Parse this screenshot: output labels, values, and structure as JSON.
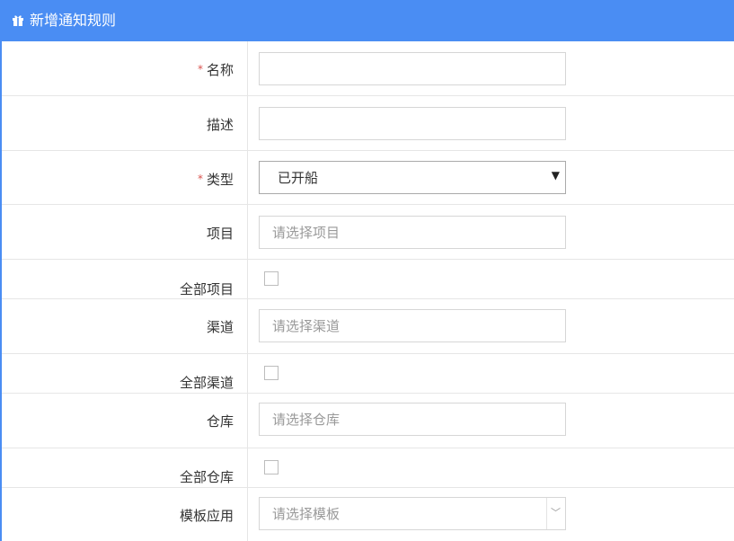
{
  "header": {
    "title": "新增通知规则",
    "icon": "gift-icon"
  },
  "form": {
    "name": {
      "label": "名称",
      "required_mark": "*",
      "value": ""
    },
    "description": {
      "label": "描述",
      "value": ""
    },
    "type": {
      "label": "类型",
      "required_mark": "*",
      "selected": "已开船"
    },
    "project": {
      "label": "项目",
      "placeholder": "请选择项目"
    },
    "all_projects": {
      "label": "全部项目",
      "checked": false
    },
    "channel": {
      "label": "渠道",
      "placeholder": "请选择渠道"
    },
    "all_channels": {
      "label": "全部渠道",
      "checked": false
    },
    "warehouse": {
      "label": "仓库",
      "placeholder": "请选择仓库"
    },
    "all_warehouses": {
      "label": "全部仓库",
      "checked": false
    },
    "template": {
      "label": "模板应用",
      "placeholder": "请选择模板"
    }
  },
  "colors": {
    "accent": "#4a8df3",
    "required": "#d9534f",
    "border": "#e6e6e6"
  }
}
